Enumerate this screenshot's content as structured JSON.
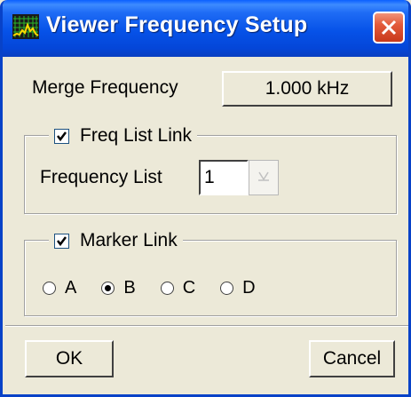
{
  "window": {
    "title": "Viewer Frequency Setup"
  },
  "merge": {
    "label": "Merge Frequency",
    "value": "1.000 kHz"
  },
  "freq_list_link": {
    "label": "Freq List Link",
    "checked": true,
    "list_label": "Frequency List",
    "list_value": "1"
  },
  "marker_link": {
    "label": "Marker Link",
    "checked": true,
    "options": [
      {
        "label": "A",
        "selected": false
      },
      {
        "label": "B",
        "selected": true
      },
      {
        "label": "C",
        "selected": false
      },
      {
        "label": "D",
        "selected": false
      }
    ]
  },
  "buttons": {
    "ok": "OK",
    "cancel": "Cancel"
  }
}
